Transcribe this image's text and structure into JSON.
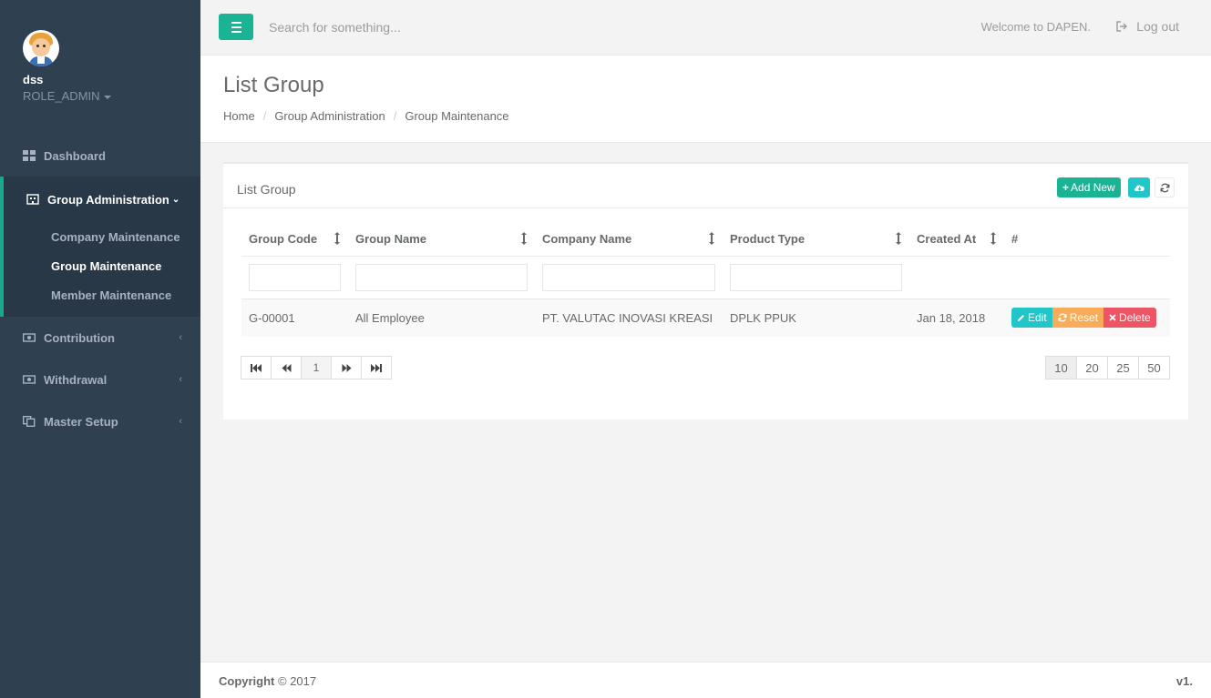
{
  "sidebar": {
    "profile": {
      "name": "dss",
      "role": "ROLE_ADMIN"
    },
    "items": [
      {
        "label": "Dashboard",
        "icon": "th-large-icon"
      },
      {
        "label": "Group Administration",
        "icon": "building-icon",
        "children": [
          "Company Maintenance",
          "Group Maintenance",
          "Member Maintenance"
        ],
        "current_child": "Group Maintenance"
      },
      {
        "label": "Contribution",
        "icon": "money-icon"
      },
      {
        "label": "Withdrawal",
        "icon": "money-icon"
      },
      {
        "label": "Master Setup",
        "icon": "copy-icon"
      }
    ]
  },
  "topbar": {
    "search_placeholder": "Search for something...",
    "welcome": "Welcome to DAPEN.",
    "logout": "Log out"
  },
  "heading": {
    "title": "List Group",
    "breadcrumb": [
      "Home",
      "Group Administration",
      "Group Maintenance"
    ]
  },
  "box": {
    "title": "List Group",
    "add_new": "Add New",
    "columns": [
      "Group Code",
      "Group Name",
      "Company Name",
      "Product Type",
      "Created At",
      "#"
    ],
    "rows": [
      {
        "group_code": "G-00001",
        "group_name": "All Employee",
        "company_name": "PT. VALUTAC INOVASI KREASI",
        "product_type": "DPLK PPUK",
        "created_at": "Jan 18, 2018"
      }
    ],
    "actions": {
      "edit": "Edit",
      "reset": "Reset",
      "delete": "Delete"
    },
    "pager": {
      "current": "1"
    },
    "page_sizes": [
      "10",
      "20",
      "25",
      "50"
    ],
    "selected_page_size": "10"
  },
  "footer": {
    "copyright_label": "Copyright",
    "copyright_year": "© 2017",
    "version": "v1."
  },
  "colors": {
    "sidebar": "#2f4050",
    "accent": "#1ab394",
    "info": "#23c6c8",
    "warning": "#f8ac59",
    "danger": "#ed5565"
  }
}
